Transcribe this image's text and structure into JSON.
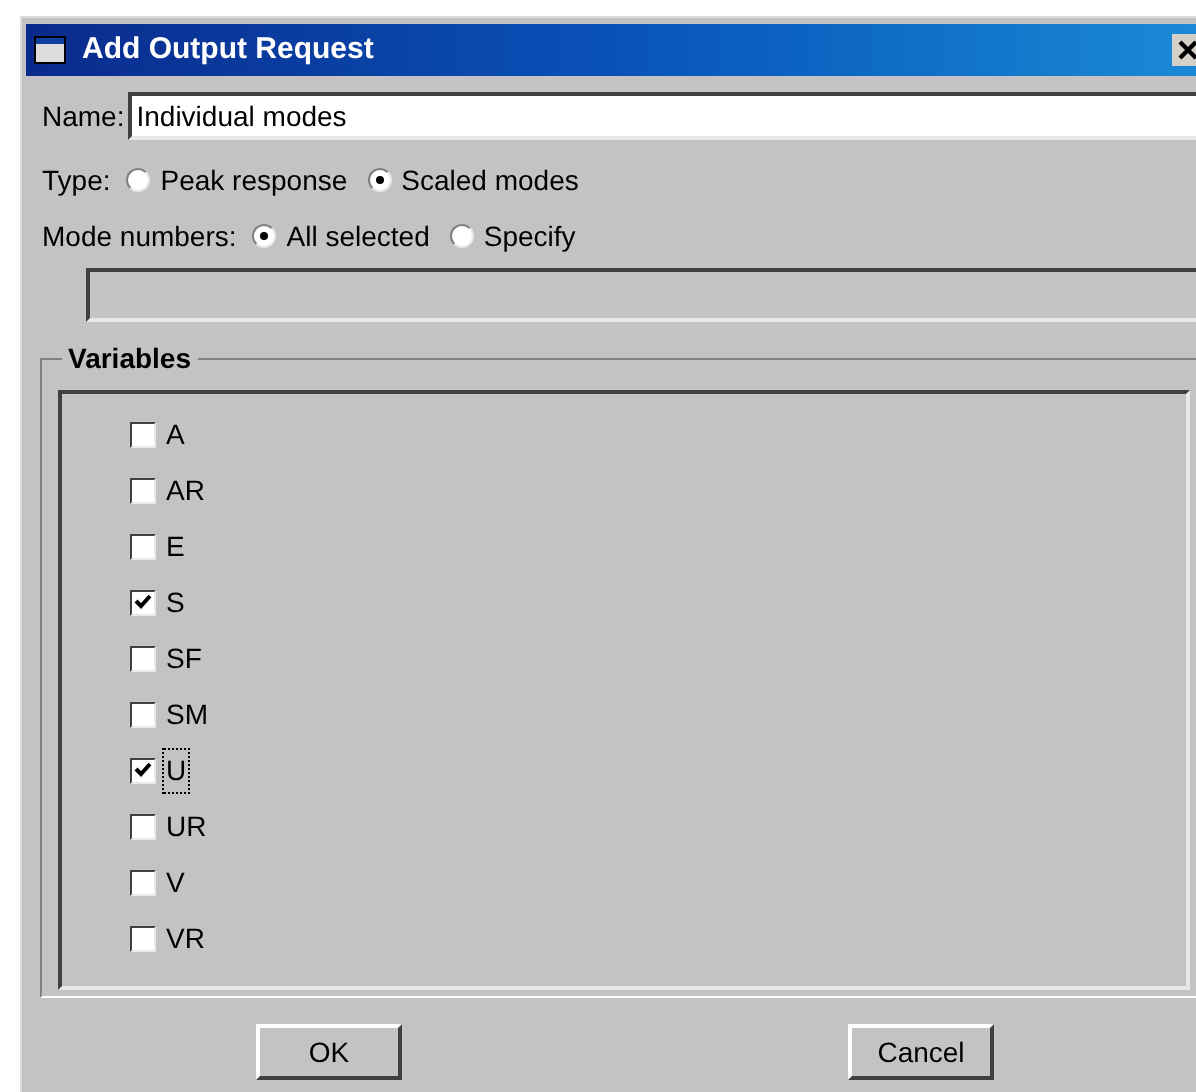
{
  "window": {
    "title": "Add Output Request"
  },
  "name": {
    "label": "Name:",
    "value": "Individual modes"
  },
  "type": {
    "label": "Type:",
    "options": [
      {
        "label": "Peak response",
        "selected": false
      },
      {
        "label": "Scaled modes",
        "selected": true
      }
    ]
  },
  "mode_numbers": {
    "label": "Mode numbers:",
    "options": [
      {
        "label": "All selected",
        "selected": true
      },
      {
        "label": "Specify",
        "selected": false
      }
    ]
  },
  "variables": {
    "title": "Variables",
    "items": [
      {
        "label": "A",
        "checked": false,
        "focused": false
      },
      {
        "label": "AR",
        "checked": false,
        "focused": false
      },
      {
        "label": "E",
        "checked": false,
        "focused": false
      },
      {
        "label": "S",
        "checked": true,
        "focused": false
      },
      {
        "label": "SF",
        "checked": false,
        "focused": false
      },
      {
        "label": "SM",
        "checked": false,
        "focused": false
      },
      {
        "label": "U",
        "checked": true,
        "focused": true
      },
      {
        "label": "UR",
        "checked": false,
        "focused": false
      },
      {
        "label": "V",
        "checked": false,
        "focused": false
      },
      {
        "label": "VR",
        "checked": false,
        "focused": false
      }
    ]
  },
  "buttons": [
    "OK",
    "Cancel"
  ]
}
